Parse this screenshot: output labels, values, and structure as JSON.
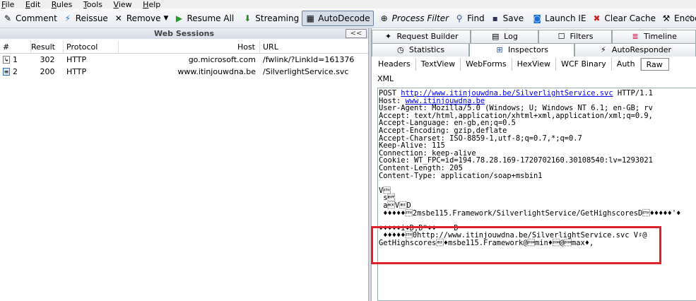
{
  "menu": [
    "File",
    "Edit",
    "Rules",
    "Tools",
    "View",
    "Help"
  ],
  "toolbar": {
    "comment": "Comment",
    "reissue": "Reissue",
    "remove": "Remove",
    "resume_all": "Resume All",
    "streaming": "Streaming",
    "autodecode": "AutoDecode",
    "process_filter": "Process Filter",
    "find": "Find",
    "save": "Save",
    "launch_ie": "Launch IE",
    "clear_cache": "Clear Cache",
    "encoder": "Encoder"
  },
  "web_sessions": {
    "title": "Web Sessions",
    "collapse_label": "<<",
    "columns": [
      "#",
      "Result",
      "Protocol",
      "Host",
      "URL"
    ],
    "rows": [
      {
        "num": "1",
        "result": "302",
        "protocol": "HTTP",
        "host": "go.microsoft.com",
        "url": "/fwlink/?LinkId=161376"
      },
      {
        "num": "2",
        "result": "200",
        "protocol": "HTTP",
        "host": "www.itinjouwdna.be",
        "url": "/SilverlightService.svc"
      }
    ]
  },
  "tabs": {
    "row1": [
      "Request Builder",
      "Log",
      "Filters",
      "Timeline"
    ],
    "row2": [
      "Statistics",
      "Inspectors",
      "AutoResponder"
    ],
    "subtabs": [
      "Headers",
      "TextView",
      "WebForms",
      "HexView",
      "WCF Binary",
      "Auth",
      "Raw"
    ],
    "xml": "XML"
  },
  "raw": {
    "method": "POST",
    "url": "http://www.itinjouwdna.be/SilverlightService.svc",
    "protocol": "HTTP/1.1",
    "host_label": "Host:",
    "host": "www.itinjouwdna.be",
    "lines": [
      "User-Agent: Mozilla/5.0 (Windows; U; Windows NT 6.1; en-GB; rv",
      "Accept: text/html,application/xhtml+xml,application/xml;q=0.9,",
      "Accept-Language: en-gb,en;q=0.5",
      "Accept-Encoding: gzip,deflate",
      "Accept-Charset: ISO-8859-1,utf-8;q=0.7,*;q=0.7",
      "Keep-Alive: 115",
      "Connection: keep-alive",
      "Cookie: WT_FPC=id=194.78.28.169-1720702160.30108540:lv=1293021",
      "Content-Length: 205",
      "Content-Type: application/soap+msbin1",
      "",
      "V\u0002",
      " s\u0004",
      " a\u0006V\bD",
      " ♦♦♦♦♦\u00022msbe115.Framework/SilverlightService/GetHighscoresD\u0002♦♦♦♦♦'♦",
      "",
      "♦♦♦♦♦i♦D,D*♦♦\t D",
      " ♦♦♦♦♦\u00020http://www.itinjouwdna.be/SilverlightService.svc V♯@",
      "GetHighscores\b♦msbe115.Framework@\u0001min♦\u0001@\u0001max♦,"
    ]
  },
  "colors": {
    "highlight_box": "#e0202a",
    "link": "#0000ee"
  }
}
